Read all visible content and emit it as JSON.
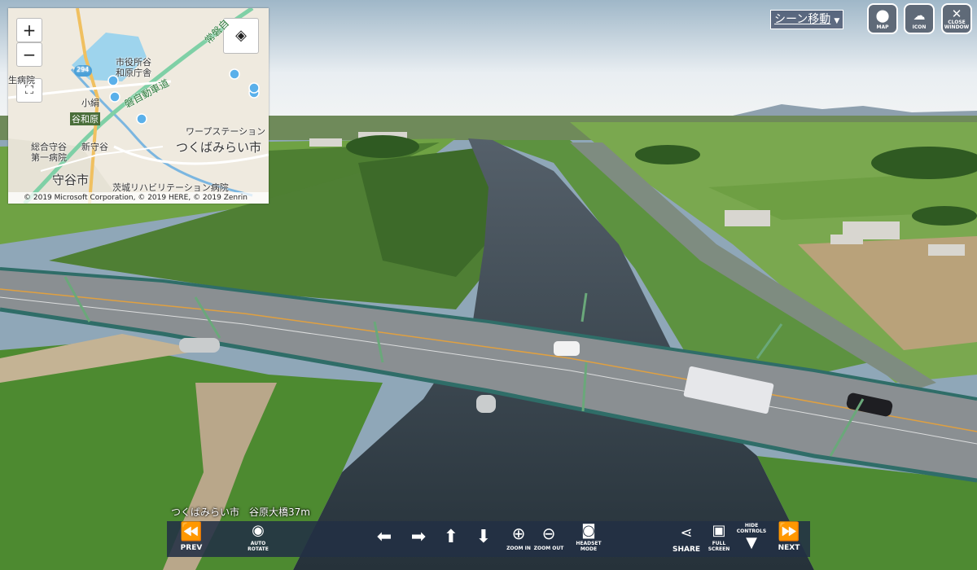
{
  "map": {
    "zoom_in": "+",
    "zoom_out": "−",
    "labels": {
      "city_office": "市役所谷",
      "wahara_office": "和原庁舎",
      "road_294": "294",
      "expressway": "磐自動車道",
      "joban": "常磐自",
      "owata": "小絹",
      "yawahara": "谷和原",
      "shinmoriya": "新守谷",
      "hospital1": "総合守谷",
      "hospital2": "第一病院",
      "moriya": "守谷市",
      "rehab": "茨城リハビリテーション病院",
      "warp": "ワープステーション",
      "tsukubamirai": "つくばみらい市",
      "edge_left": "生病院"
    },
    "copyright": "© 2019 Microsoft Corporation, © 2019 HERE, © 2019 Zenrin"
  },
  "topbar": {
    "scene_select": "シーン移動",
    "map_button": "MAP",
    "icon_button": "ICON",
    "close_button_1": "CLOSE",
    "close_button_2": "WINDOW"
  },
  "caption": "つくばみらい市　谷原大橋37m",
  "controls": {
    "prev": "PREV",
    "auto_rotate_1": "AUTO",
    "auto_rotate_2": "ROTATE",
    "zoom_in": "ZOOM IN",
    "zoom_out": "ZOOM OUT",
    "headset_1": "HEADSET",
    "headset_2": "MODE",
    "share": "SHARE",
    "fullscreen_1": "FULL",
    "fullscreen_2": "SCREEN",
    "hide_controls_1": "HIDE",
    "hide_controls_2": "CONTROLS",
    "next": "NEXT"
  },
  "colors": {
    "control_bar": "#223044",
    "river": "#2c3a44",
    "field": "#5f9a3c"
  }
}
